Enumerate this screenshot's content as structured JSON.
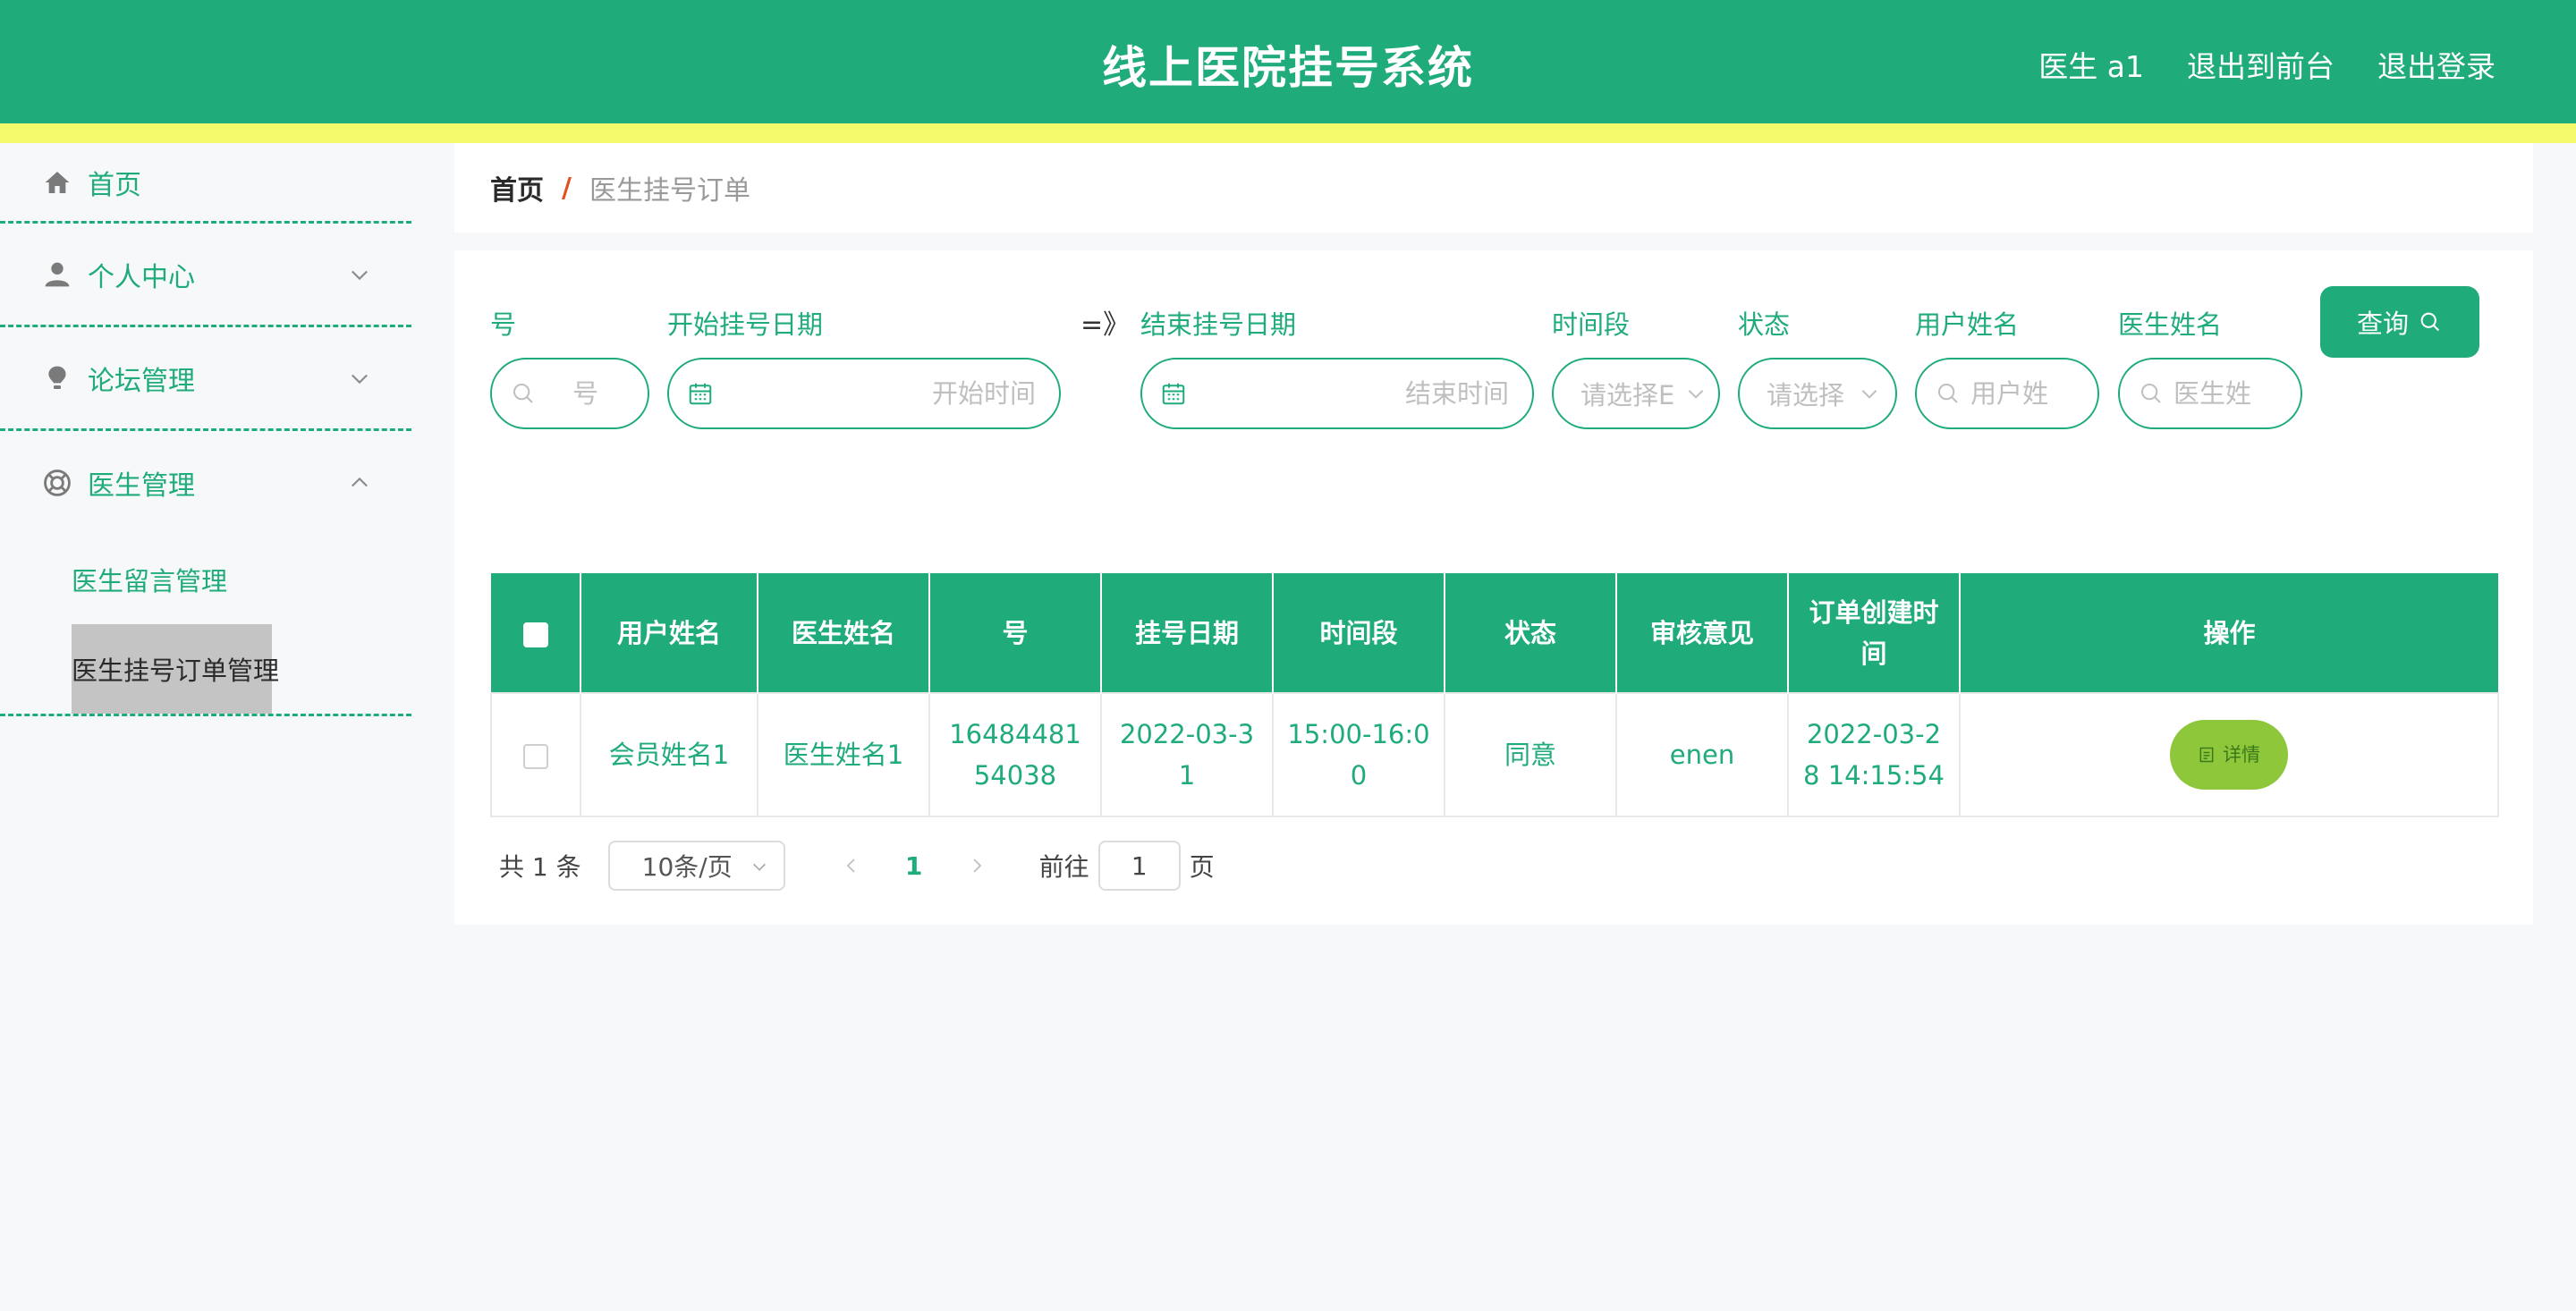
{
  "header": {
    "title": "线上医院挂号系统",
    "links": [
      "医生 a1",
      "退出到前台",
      "退出登录"
    ]
  },
  "sidebar": {
    "items": [
      {
        "label": "首页",
        "icon": "home-icon"
      },
      {
        "label": "个人中心",
        "icon": "user-icon"
      },
      {
        "label": "论坛管理",
        "icon": "bulb-icon"
      },
      {
        "label": "医生管理",
        "icon": "lifebuoy-icon"
      }
    ],
    "submenu": [
      "医生留言管理",
      "医生挂号订单管理"
    ]
  },
  "breadcrumb": {
    "home": "首页",
    "separator": "/",
    "current": "医生挂号订单"
  },
  "filters": {
    "number_label": "号",
    "number_placeholder": "号",
    "start_label": "开始挂号日期",
    "start_placeholder": "开始时间",
    "range_sep": "=》",
    "end_label": "结束挂号日期",
    "end_placeholder": "结束时间",
    "period_label": "时间段",
    "period_placeholder": "请选择E",
    "status_label": "状态",
    "status_placeholder": "请选择",
    "user_label": "用户姓名",
    "user_placeholder": "用户姓",
    "doctor_label": "医生姓名",
    "doctor_placeholder": "医生姓",
    "query_label": "查询"
  },
  "table": {
    "headers": [
      "用户姓名",
      "医生姓名",
      "号",
      "挂号日期",
      "时间段",
      "状态",
      "审核意见",
      "订单创建时间",
      "操作"
    ],
    "rows": [
      {
        "user": "会员姓名1",
        "doctor": "医生姓名1",
        "number": "1648448154038",
        "date": "2022-03-31",
        "period": "15:00-16:00",
        "status": "同意",
        "opinion": "enen",
        "created": "2022-03-28 14:15:54",
        "action": "详情"
      }
    ]
  },
  "pagination": {
    "total": "共 1 条",
    "page_size": "10条/页",
    "current_page": "1",
    "goto_label": "前往",
    "goto_value": "1",
    "page_suffix": "页"
  },
  "colors": {
    "primary": "#1fab7a",
    "stripe": "#f3f96a",
    "detail_button": "#8ec73a"
  }
}
